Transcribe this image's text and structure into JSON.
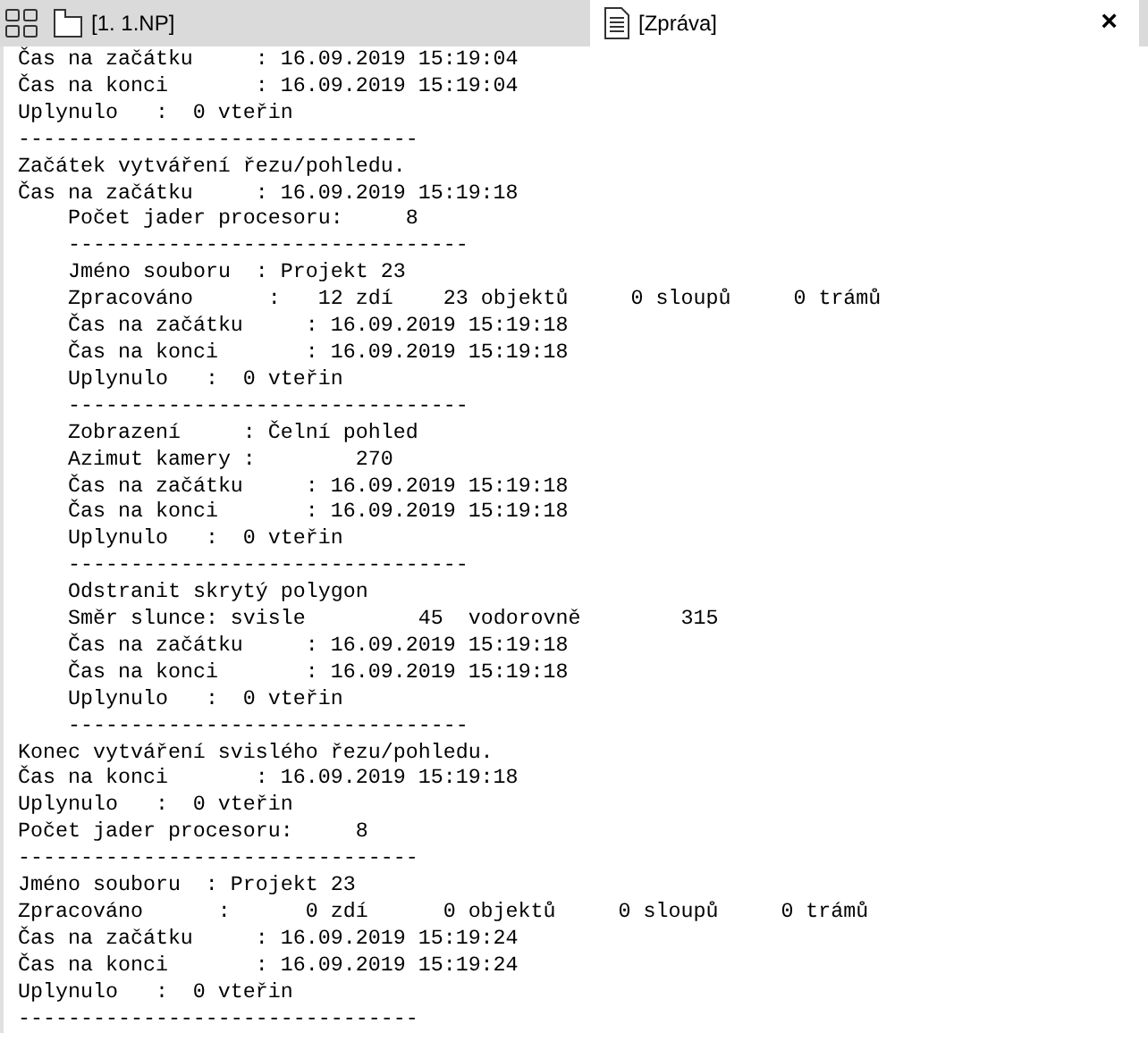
{
  "tabs": [
    {
      "label": "[1. 1.NP]",
      "selected": false,
      "closable": false
    },
    {
      "label": "[Zpráva]",
      "selected": true,
      "closable": true
    }
  ],
  "close_glyph": "×",
  "log": [
    {
      "text": "Čas na začátku     : 16.09.2019 15:19:04"
    },
    {
      "text": "Čas na konci       : 16.09.2019 15:19:04"
    },
    {
      "text": "Uplynulo   :  0 vteřin"
    },
    {
      "text": "--------------------------------"
    },
    {
      "text": "Začátek vytváření řezu/pohledu."
    },
    {
      "text": "Čas na začátku     : 16.09.2019 15:19:18",
      "children": [
        {
          "text": "Počet jader procesoru:     8"
        },
        {
          "text": "--------------------------------"
        },
        {
          "text": "Jméno souboru  : Projekt 23"
        },
        {
          "text": "Zpracováno      :   12 zdí    23 objektů     0 sloupů     0 trámů"
        },
        {
          "text": "Čas na začátku     : 16.09.2019 15:19:18"
        },
        {
          "text": "Čas na konci       : 16.09.2019 15:19:18"
        },
        {
          "text": "Uplynulo   :  0 vteřin"
        },
        {
          "text": "--------------------------------"
        },
        {
          "text": "Zobrazení     : Čelní pohled"
        },
        {
          "text": "Azimut kamery :        270"
        },
        {
          "text": "Čas na začátku     : 16.09.2019 15:19:18"
        },
        {
          "text": "Čas na konci       : 16.09.2019 15:19:18"
        },
        {
          "text": "Uplynulo   :  0 vteřin"
        },
        {
          "text": "--------------------------------"
        },
        {
          "text": "Odstranit skrytý polygon"
        },
        {
          "text": "Směr slunce: svisle         45  vodorovně        315"
        },
        {
          "text": "Čas na začátku     : 16.09.2019 15:19:18"
        },
        {
          "text": "Čas na konci       : 16.09.2019 15:19:18"
        },
        {
          "text": "Uplynulo   :  0 vteřin"
        },
        {
          "text": "--------------------------------"
        }
      ]
    },
    {
      "text": "Konec vytváření svislého řezu/pohledu."
    },
    {
      "text": "Čas na konci       : 16.09.2019 15:19:18"
    },
    {
      "text": "Uplynulo   :  0 vteřin"
    },
    {
      "text": "Počet jader procesoru:     8"
    },
    {
      "text": "--------------------------------"
    },
    {
      "text": "Jméno souboru  : Projekt 23"
    },
    {
      "text": "Zpracováno      :      0 zdí      0 objektů     0 sloupů     0 trámů"
    },
    {
      "text": "Čas na začátku     : 16.09.2019 15:19:24"
    },
    {
      "text": "Čas na konci       : 16.09.2019 15:19:24"
    },
    {
      "text": "Uplynulo   :  0 vteřin"
    },
    {
      "text": "--------------------------------"
    }
  ]
}
